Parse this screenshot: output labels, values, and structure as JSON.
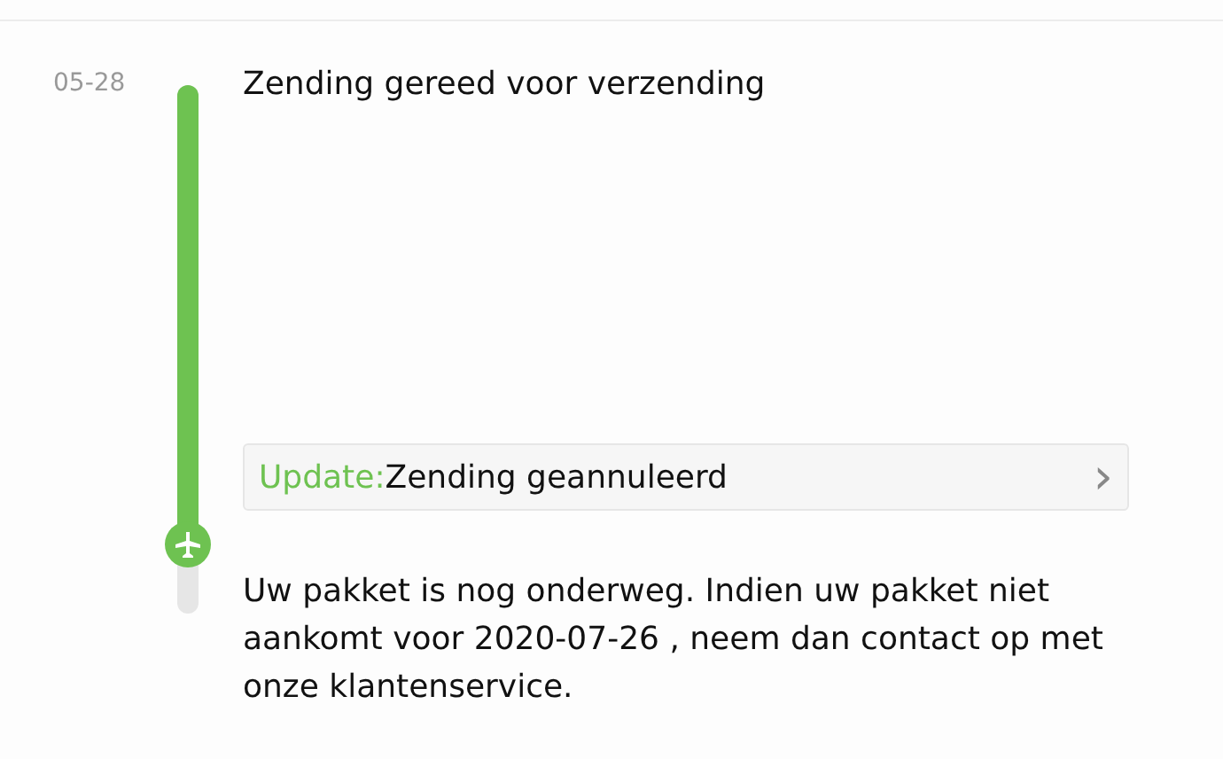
{
  "event": {
    "date": "05-28",
    "title": "Zending gereed voor verzending"
  },
  "progress": {
    "level": 0.87
  },
  "update": {
    "label": "Update:",
    "text": "Zending geannuleerd",
    "arrow": "›"
  },
  "message": "Uw pakket is nog onderweg. Indien uw pakket niet aankomt voor 2020-07-26 , neem dan contact op met onze klantenservice."
}
